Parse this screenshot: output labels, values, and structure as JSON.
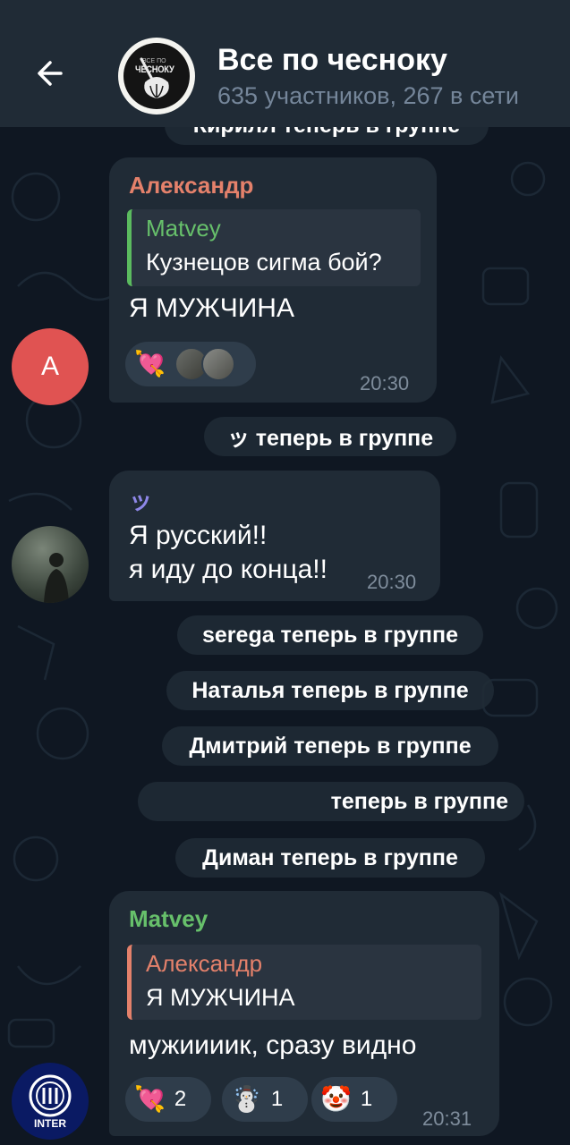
{
  "header": {
    "title": "Все по чесноку",
    "subtitle": "635 участников, 267 в сети",
    "avatar_logo_small": "ВСЕ ПО",
    "avatar_logo_text": "ЧЕСНОКУ"
  },
  "service_messages": {
    "cut_top": "Кирилл теперь в группе",
    "joined_1": "ッ теперь в группе",
    "joined_2": "serega теперь в группе",
    "joined_3": "Наталья теперь в группе",
    "joined_4": "Дмитрий теперь в группе",
    "joined_5": "теперь в группе",
    "joined_6": "Диман теперь в группе"
  },
  "messages": [
    {
      "sender": "Александр",
      "sender_color": "#e4816b",
      "avatar_letter": "А",
      "avatar_color": "#e05352",
      "reply_name": "Matvey",
      "reply_text": "Кузнецов сигма бой?",
      "text": "Я МУЖЧИНА",
      "time": "20:30",
      "reactions": [
        {
          "icon": "heart-arrow",
          "emoji": "💘"
        }
      ]
    },
    {
      "sender": "ッ",
      "sender_color": "#8e87e8",
      "lines": [
        "Я русский!!",
        "я иду до конца!!"
      ],
      "time": "20:30"
    },
    {
      "sender": "Matvey",
      "sender_color": "#67c06b",
      "avatar_text": "INTER",
      "reply_name": "Александр",
      "reply_text": "Я МУЖЧИНА",
      "text": "мужиииик, сразу видно",
      "time": "20:31",
      "reactions": [
        {
          "icon": "heart-arrow",
          "emoji": "💘",
          "count": "2"
        },
        {
          "icon": "snowman",
          "emoji": "☃️",
          "count": "1"
        },
        {
          "icon": "clown",
          "emoji": "🤡",
          "count": "1"
        }
      ]
    }
  ],
  "colors": {
    "background": "#0f1722",
    "header": "#202b36",
    "bubble": "#202b36",
    "reply_bar_green": "#5bbb5f",
    "reply_bar_red": "#e4816b",
    "reaction_bg": "#2f3d4b"
  }
}
